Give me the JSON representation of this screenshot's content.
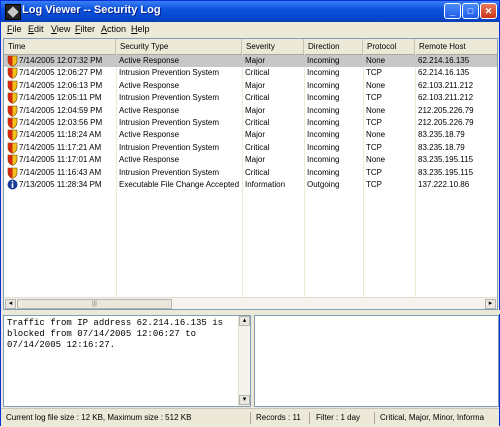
{
  "window": {
    "title": "Log Viewer  -- Security Log"
  },
  "title_buttons": {
    "minimize": "_",
    "maximize": "□",
    "close": "✕"
  },
  "menu": [
    {
      "label": "File",
      "accel": "F",
      "rest": "ile"
    },
    {
      "label": "Edit",
      "accel": "E",
      "rest": "dit"
    },
    {
      "label": "View",
      "accel": "V",
      "rest": "iew"
    },
    {
      "label": "Filter",
      "accel": "F",
      "rest": "ilter"
    },
    {
      "label": "Action",
      "accel": "A",
      "rest": "ction"
    },
    {
      "label": "Help",
      "accel": "H",
      "rest": "elp"
    }
  ],
  "columns": [
    "Time",
    "Security Type",
    "Severity",
    "Direction",
    "Protocol",
    "Remote Host"
  ],
  "rows": [
    {
      "icon": "shield-icon",
      "time": "7/14/2005 12:07:32 PM",
      "type": "Active Response",
      "severity": "Major",
      "direction": "Incoming",
      "protocol": "None",
      "host": "62.214.16.135",
      "selected": true
    },
    {
      "icon": "shield-icon",
      "time": "7/14/2005 12:06:27 PM",
      "type": "Intrusion Prevention System",
      "severity": "Critical",
      "direction": "Incoming",
      "protocol": "TCP",
      "host": "62.214.16.135"
    },
    {
      "icon": "shield-icon",
      "time": "7/14/2005 12:06:13 PM",
      "type": "Active Response",
      "severity": "Major",
      "direction": "Incoming",
      "protocol": "None",
      "host": "62.103.211.212"
    },
    {
      "icon": "shield-icon",
      "time": "7/14/2005 12:05:11 PM",
      "type": "Intrusion Prevention System",
      "severity": "Critical",
      "direction": "Incoming",
      "protocol": "TCP",
      "host": "62.103.211.212"
    },
    {
      "icon": "shield-icon",
      "time": "7/14/2005 12:04:59 PM",
      "type": "Active Response",
      "severity": "Major",
      "direction": "Incoming",
      "protocol": "None",
      "host": "212.205.226.79"
    },
    {
      "icon": "shield-icon",
      "time": "7/14/2005 12:03:56 PM",
      "type": "Intrusion Prevention System",
      "severity": "Critical",
      "direction": "Incoming",
      "protocol": "TCP",
      "host": "212.205.226.79"
    },
    {
      "icon": "shield-icon",
      "time": "7/14/2005 11:18:24 AM",
      "type": "Active Response",
      "severity": "Major",
      "direction": "Incoming",
      "protocol": "None",
      "host": "83.235.18.79"
    },
    {
      "icon": "shield-icon",
      "time": "7/14/2005 11:17:21 AM",
      "type": "Intrusion Prevention System",
      "severity": "Critical",
      "direction": "Incoming",
      "protocol": "TCP",
      "host": "83.235.18.79"
    },
    {
      "icon": "shield-icon",
      "time": "7/14/2005 11:17:01 AM",
      "type": "Active Response",
      "severity": "Major",
      "direction": "Incoming",
      "protocol": "None",
      "host": "83.235.195.115"
    },
    {
      "icon": "shield-icon",
      "time": "7/14/2005 11:16:43 AM",
      "type": "Intrusion Prevention System",
      "severity": "Critical",
      "direction": "Incoming",
      "protocol": "TCP",
      "host": "83.235.195.115"
    },
    {
      "icon": "info-icon",
      "time": "7/13/2005 11:28:34 PM",
      "type": "Executable File Change Accepted",
      "severity": "Information",
      "direction": "Outgoing",
      "protocol": "TCP",
      "host": "137.222.10.86"
    }
  ],
  "detail": {
    "text": "Traffic from IP address 62.214.16.135 is blocked from 07/14/2005 12:06:27 to 07/14/2005 12:16:27."
  },
  "status": {
    "size": "Current log file size : 12 KB, Maximum size : 512 KB",
    "records": "Records : 11",
    "filter": "Filter : 1 day",
    "severities": "Critical, Major, Minor, Informa"
  },
  "colors": {
    "titlebar": "#0a52dc",
    "selected_row": "#c7c7c7",
    "shield_red": "#d42a12",
    "shield_yellow": "#f2c21b",
    "info_blue": "#1a3d99"
  }
}
